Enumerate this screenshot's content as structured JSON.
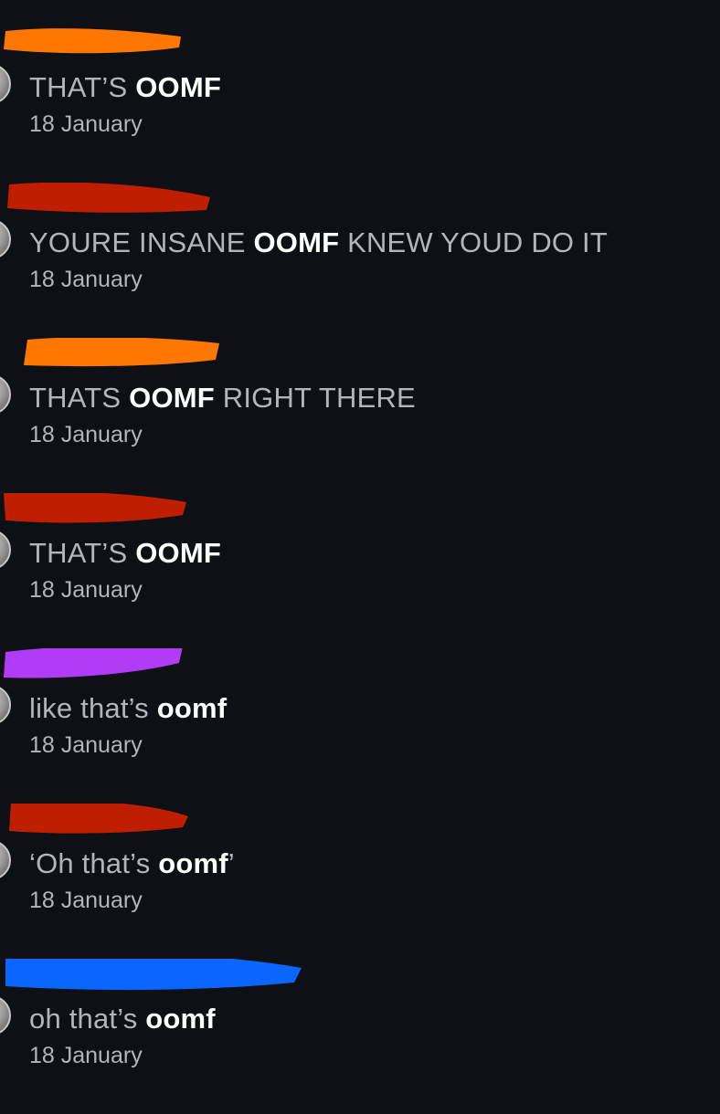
{
  "comments": [
    {
      "pre": "THAT’S ",
      "hl": "OOMF",
      "post": "",
      "date": "18 January",
      "redact_color": "#ff7700"
    },
    {
      "pre": "YOURE INSANE ",
      "hl": "OOMF",
      "post": " KNEW YOUD DO IT",
      "date": "18 January",
      "redact_color": "#c01e00"
    },
    {
      "pre": "THATS ",
      "hl": "OOMF",
      "post": " RIGHT THERE",
      "date": "18 January",
      "redact_color": "#ff7700"
    },
    {
      "pre": "THAT’S ",
      "hl": "OOMF",
      "post": "",
      "date": "18 January",
      "redact_color": "#c01e00"
    },
    {
      "pre": "like that’s ",
      "hl": "oomf",
      "post": "",
      "date": "18 January",
      "redact_color": "#b23cf5"
    },
    {
      "pre": "‘Oh that’s ",
      "hl": "oomf",
      "post": "’",
      "date": "18 January",
      "redact_color": "#c01e00"
    },
    {
      "pre": "oh that’s ",
      "hl": "oomf",
      "post": "",
      "date": "18 January",
      "redact_color": "#0a66ff"
    }
  ]
}
